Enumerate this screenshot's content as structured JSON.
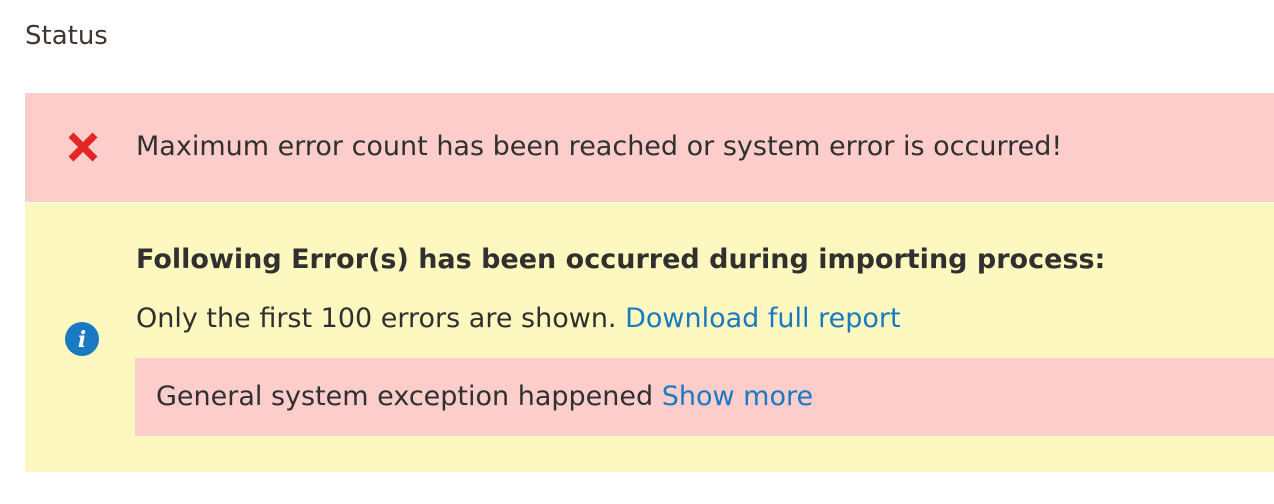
{
  "status": {
    "title": "Status"
  },
  "error_message": {
    "icon": "error-x-icon",
    "text": "Maximum error count has been reached or system error is occurred!",
    "color": "#fdcdcc",
    "icon_color": "#e22626"
  },
  "notice": {
    "icon": "info-icon",
    "heading": "Following Error(s) has been occurred during importing process:",
    "shown_text": "Only the first 100 errors are shown.",
    "download_link": "Download full report",
    "color": "#fdf8bf",
    "icon_color": "#1979c3",
    "link_color": "#1979c3"
  },
  "exception": {
    "text": "General system exception happened",
    "show_more": "Show more"
  }
}
